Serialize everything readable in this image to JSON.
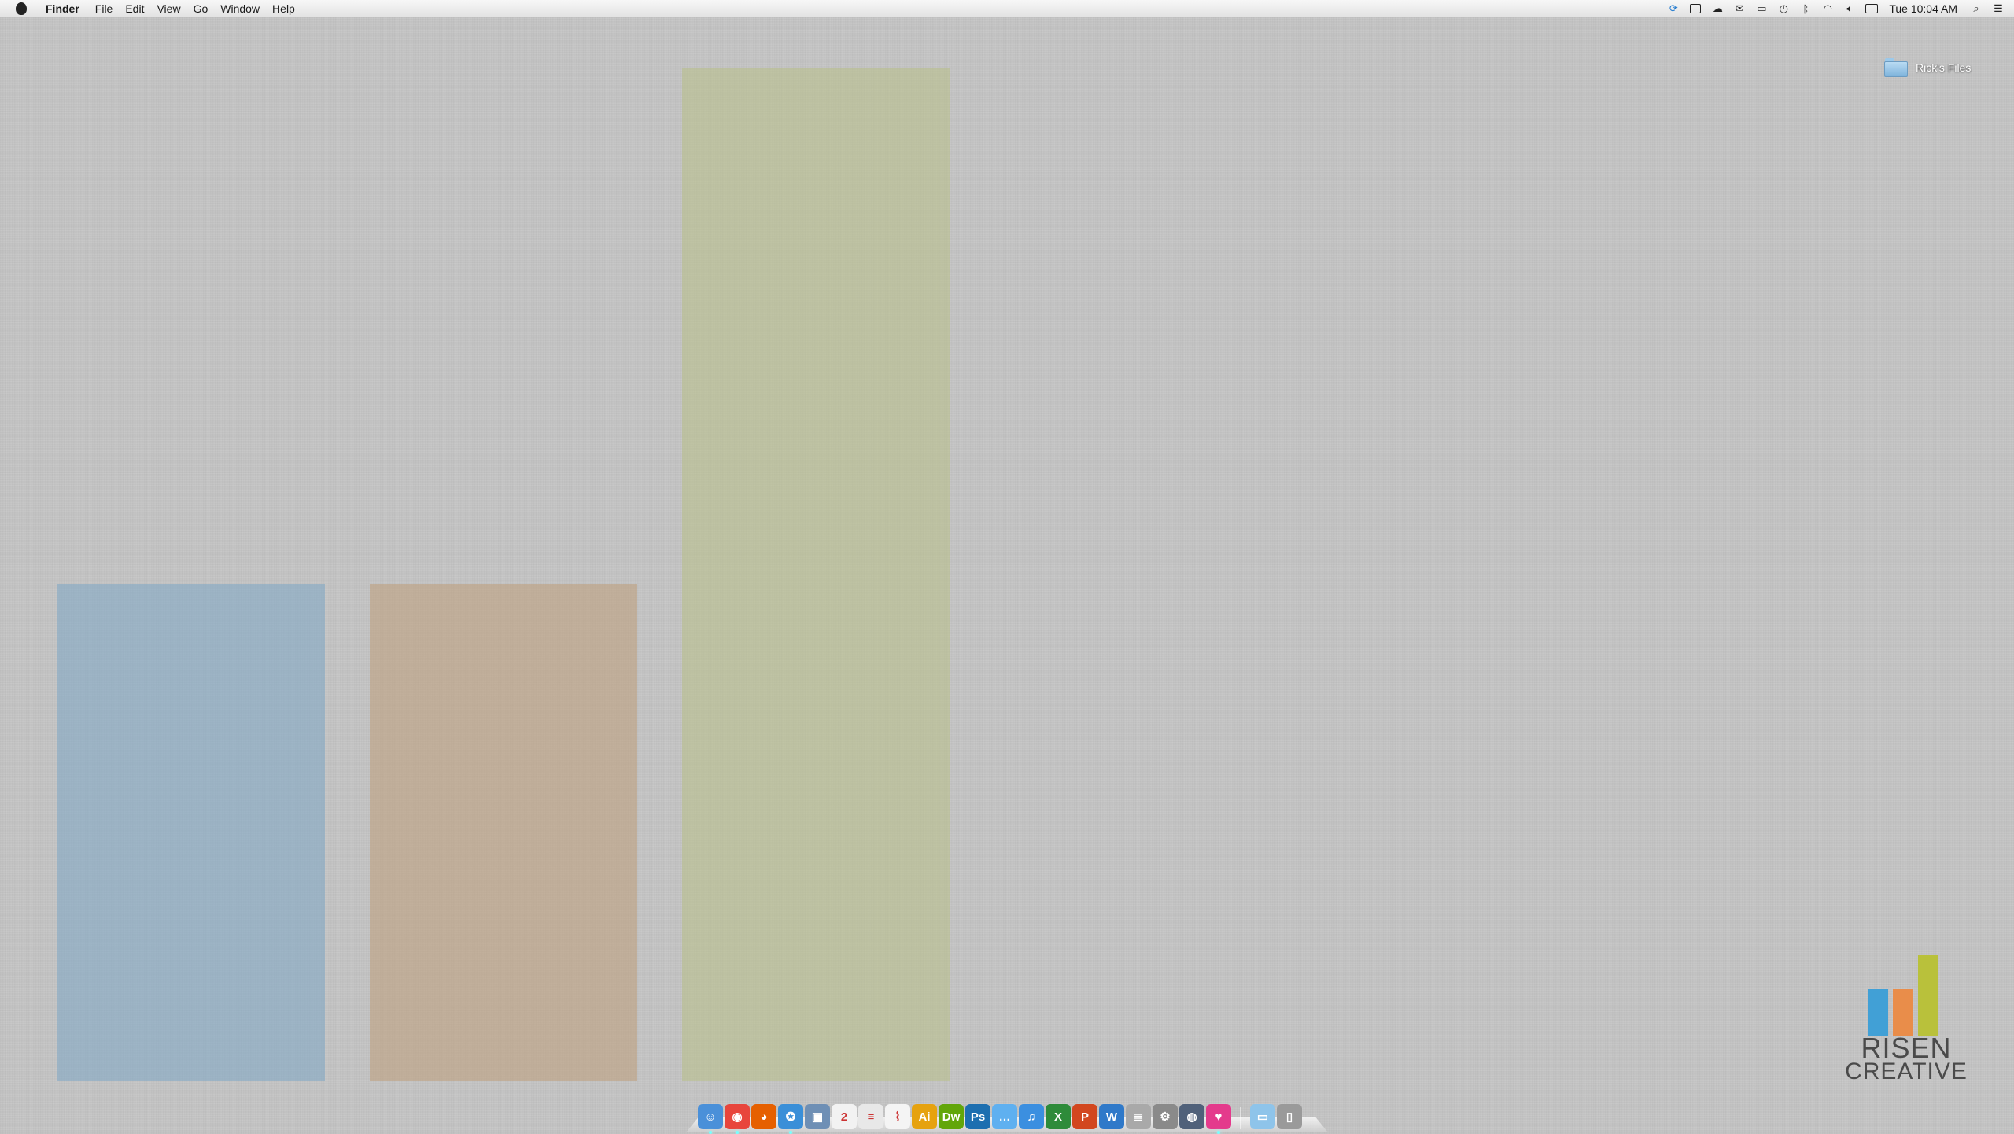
{
  "menubar": {
    "app_name": "Finder",
    "menus": [
      "File",
      "Edit",
      "View",
      "Go",
      "Window",
      "Help"
    ],
    "clock": "Tue 10:04 AM",
    "status_icons": [
      "sync-icon",
      "screen-icon",
      "cloud-upload-icon",
      "chat-icon",
      "airplay-icon",
      "time-machine-icon",
      "bluetooth-icon",
      "wifi-icon",
      "volume-icon",
      "battery-icon"
    ]
  },
  "desktop": {
    "folder_label": "Rick's Files"
  },
  "wallpaper": {
    "logo_line1": "RISEN",
    "logo_line2": "CREATIVE",
    "colors": {
      "blue": "#41a0d6",
      "orange": "#e98d4a",
      "green": "#b9c13b"
    }
  },
  "dock": {
    "apps": [
      {
        "name": "Finder",
        "icon": "finder-icon",
        "color": "#4a90d9",
        "glyph": "☺"
      },
      {
        "name": "Chrome",
        "icon": "chrome-icon",
        "color": "#e8453c",
        "glyph": "◉"
      },
      {
        "name": "Firefox",
        "icon": "firefox-icon",
        "color": "#e66000",
        "glyph": "◕"
      },
      {
        "name": "Safari",
        "icon": "safari-icon",
        "color": "#3a8fd8",
        "glyph": "✪"
      },
      {
        "name": "Preview",
        "icon": "preview-icon",
        "color": "#6e8fb5",
        "glyph": "▣"
      },
      {
        "name": "iCal",
        "icon": "calendar-icon",
        "color": "#f2f2f2",
        "glyph": "2"
      },
      {
        "name": "TextEdit",
        "icon": "textedit-icon",
        "color": "#e8e8e8",
        "glyph": "≡"
      },
      {
        "name": "Acrobat",
        "icon": "acrobat-icon",
        "color": "#f4f4f4",
        "glyph": "⌇"
      },
      {
        "name": "Illustrator",
        "icon": "illustrator-icon",
        "color": "#e6a20f",
        "glyph": "Ai"
      },
      {
        "name": "Dreamweaver",
        "icon": "dreamweaver-icon",
        "color": "#62a60a",
        "glyph": "Dw"
      },
      {
        "name": "Photoshop",
        "icon": "photoshop-icon",
        "color": "#1d6fb0",
        "glyph": "Ps"
      },
      {
        "name": "Messages",
        "icon": "messages-icon",
        "color": "#5fb0f0",
        "glyph": "…"
      },
      {
        "name": "iTunes",
        "icon": "itunes-icon",
        "color": "#3b8fe0",
        "glyph": "♫"
      },
      {
        "name": "Excel",
        "icon": "excel-icon",
        "color": "#2e8b3a",
        "glyph": "X"
      },
      {
        "name": "PowerPoint",
        "icon": "powerpoint-icon",
        "color": "#d2471f",
        "glyph": "P"
      },
      {
        "name": "Word",
        "icon": "word-icon",
        "color": "#2f79c9",
        "glyph": "W"
      },
      {
        "name": "FileMerge",
        "icon": "filemerge-icon",
        "color": "#a9a9a9",
        "glyph": "≣"
      },
      {
        "name": "System Preferences",
        "icon": "gear-icon",
        "color": "#8a8a8a",
        "glyph": "⚙"
      },
      {
        "name": "Network Utility",
        "icon": "network-icon",
        "color": "#50617a",
        "glyph": "◍"
      },
      {
        "name": "Heart App",
        "icon": "heart-icon",
        "color": "#e43a8c",
        "glyph": "♥"
      }
    ],
    "trailing": [
      {
        "name": "Downloads",
        "icon": "downloads-folder-icon",
        "color": "#8ec4ea",
        "glyph": "▭"
      },
      {
        "name": "Trash",
        "icon": "trash-icon",
        "color": "#9a9a9a",
        "glyph": "▯"
      }
    ]
  }
}
